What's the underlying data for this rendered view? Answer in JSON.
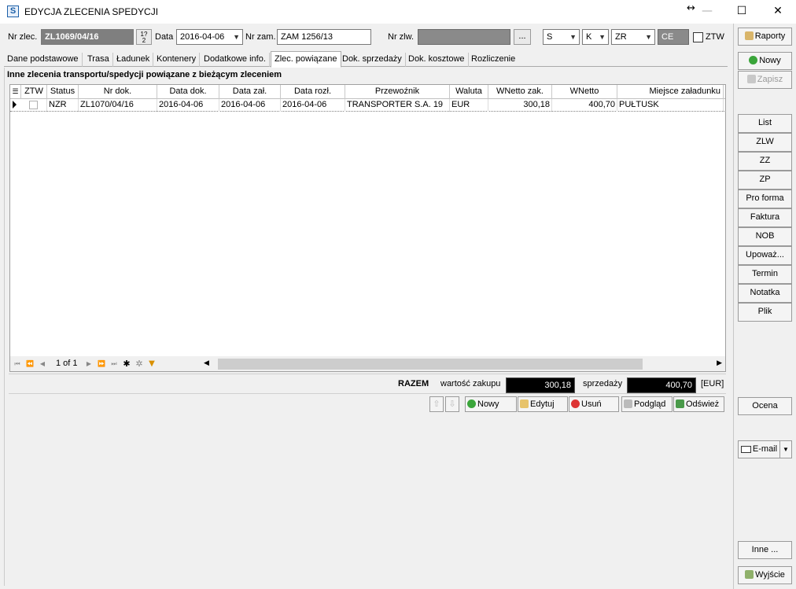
{
  "window": {
    "title": "EDYCJA ZLECENIA SPEDYCJI",
    "icon_letter": "S",
    "controls": {
      "minimize": "—",
      "maximize": "☐",
      "close": "✕",
      "resize": "↔"
    }
  },
  "header": {
    "nr_zlec_label": "Nr zlec.",
    "nr_zlec_value": "ZL1069/04/16",
    "data_label": "Data",
    "data_value": "2016-04-06",
    "nr_zam_label": "Nr zam.",
    "nr_zam_value": "ZAM 1256/13",
    "nr_zlw_label": "Nr zlw.",
    "nr_zlw_value": "",
    "ellipsis": "...",
    "s_select": "S",
    "k_select": "K",
    "zr_select": "ZR",
    "ce_value": "CE",
    "ztw_label": "ZTW"
  },
  "tabs": [
    {
      "label": "Dane podstawowe"
    },
    {
      "label": "Trasa"
    },
    {
      "label": "Ładunek"
    },
    {
      "label": "Kontenery"
    },
    {
      "label": "Dodatkowe info."
    },
    {
      "label": "Zlec. powiązane"
    },
    {
      "label": "Dok. sprzedaży"
    },
    {
      "label": "Dok. kosztowe"
    },
    {
      "label": "Rozliczenie"
    }
  ],
  "active_tab": "Zlec. powiązane",
  "panel": {
    "title": "Inne zlecenia transportu/spedycji powiązane z bieżącym zleceniem",
    "columns": [
      "ZTW",
      "Status",
      "Nr dok.",
      "Data dok.",
      "Data zał.",
      "Data rozł.",
      "Przewoźnik",
      "Waluta",
      "WNetto zak.",
      "WNetto",
      "Miejsce załadunku"
    ],
    "rows": [
      {
        "status": "NZR",
        "nr_dok": "ZL1070/04/16",
        "data_dok": "2016-04-06",
        "data_zal": "2016-04-06",
        "data_rozl": "2016-04-06",
        "przewoznik": "TRANSPORTER S.A. 19",
        "waluta": "EUR",
        "wnetto_zak": "300,18",
        "wnetto": "400,70",
        "miejsce": "PUŁTUSK"
      }
    ],
    "navigator": {
      "page_text": "1 of 1"
    },
    "summary": {
      "razem_label": "RAZEM",
      "zakup_label": "wartość zakupu",
      "zakup_value": "300,18",
      "sprzedaz_label": "sprzedaży",
      "sprzedaz_value": "400,70",
      "currency": "[EUR]"
    },
    "buttons": {
      "nowy": "Nowy",
      "edytuj": "Edytuj",
      "usun": "Usuń",
      "podglad": "Podgląd",
      "odswiez": "Odśwież"
    }
  },
  "sidebar": {
    "raporty": "Raporty",
    "nowy": "Nowy",
    "zapisz": "Zapisz",
    "list_items": [
      "List",
      "ZLW",
      "ZZ",
      "ZP",
      "Pro forma",
      "Faktura",
      "NOB",
      "Upoważ...",
      "Termin",
      "Notatka",
      "Plik"
    ],
    "ocena": "Ocena",
    "email": "E-mail",
    "inne": "Inne ...",
    "wyjscie": "Wyjście"
  }
}
